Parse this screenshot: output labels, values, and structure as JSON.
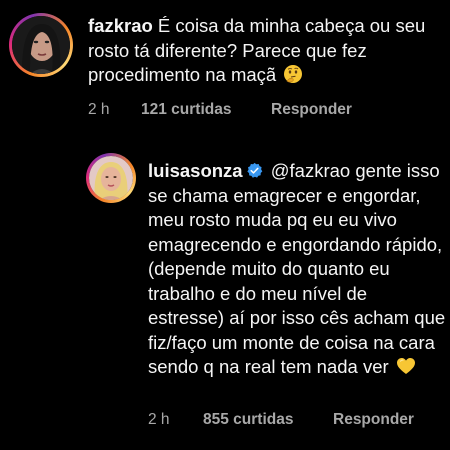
{
  "comment": {
    "username": "fazkrao",
    "text": "É coisa da minha cabeça ou seu rosto tá diferente? Parece que fez procedimento na maçã",
    "emoji": "thinking-face-emoji",
    "time": "2 h",
    "likes": "121 curtidas",
    "reply_label": "Responder"
  },
  "reply": {
    "username": "luisasonza",
    "verified": true,
    "text": "@fazkrao gente isso se chama emagrecer e engordar, meu rosto muda pq eu eu vivo emagrecendo e engordando rápido, (depende muito do quanto eu trabalho e do meu nível de estresse) aí por isso cês acham que fiz/faço um monte de coisa na cara sendo q na real tem nada ver",
    "emoji": "yellow-heart-emoji",
    "time": "2 h",
    "likes": "855 curtidas",
    "reply_label": "Responder"
  },
  "colors": {
    "background": "#000000",
    "text": "#f5f5f5",
    "meta": "#a8a8a8",
    "verified_badge": "#3897f0"
  }
}
